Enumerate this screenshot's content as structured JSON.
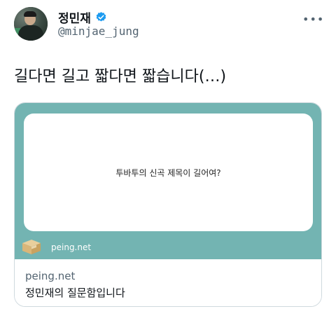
{
  "user": {
    "name": "정민재",
    "handle": "@minjae_jung"
  },
  "tweet": {
    "text": "길다면 길고 짧다면 짧습니다(…)"
  },
  "card": {
    "question": "투바투의 신곡 제목이 길어여?",
    "site_label": "peing.net",
    "domain": "peing.net",
    "title": "정민재의 질문함입니다"
  },
  "icons": {
    "verified": "verified-badge-icon",
    "more": "more-options-icon",
    "box": "peing-box-icon"
  },
  "colors": {
    "card_bg": "#73b4b2",
    "verified": "#1d9bf0",
    "secondary_text": "#536471"
  }
}
